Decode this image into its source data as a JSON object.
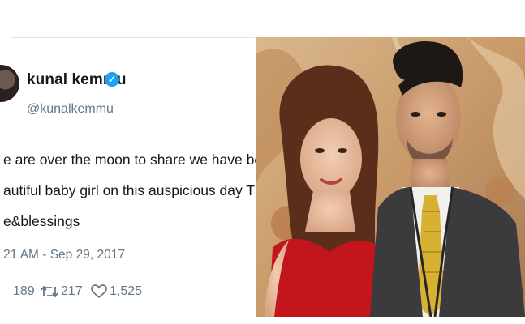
{
  "tweet": {
    "author_name": "kunal kemmu",
    "verified_icon": "verified-badge-icon",
    "handle": "@kunalkemmu",
    "text_lines": [
      "e are over the moon to share we have been bless",
      "autiful baby girl on this auspicious day Thank you",
      "e&blessings"
    ],
    "timestamp": "21 AM - Sep 29, 2017",
    "stats": {
      "replies": "189",
      "retweets": "217",
      "likes": "1,525"
    }
  },
  "colors": {
    "verified_blue": "#1da1f2",
    "muted_gray": "#657786",
    "text": "#14171a"
  },
  "photo": {
    "description_icon": "couple-photo"
  }
}
